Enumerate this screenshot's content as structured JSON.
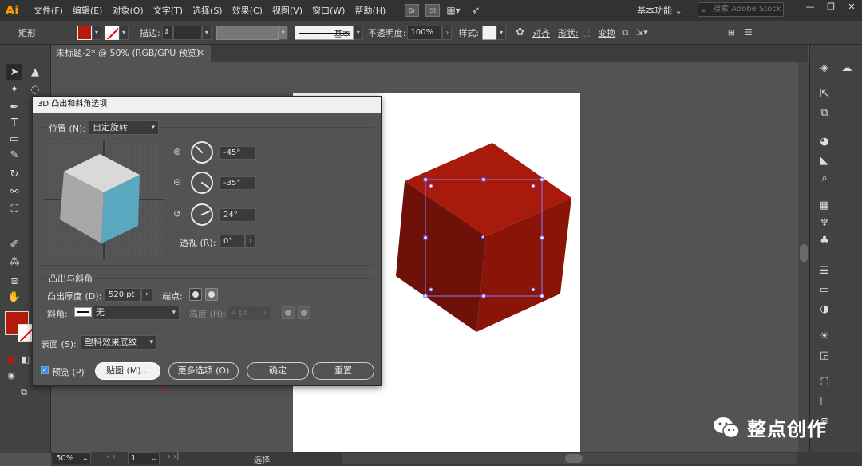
{
  "app": {
    "logo": "Ai"
  },
  "menu": {
    "items": [
      "文件(F)",
      "编辑(E)",
      "对象(O)",
      "文字(T)",
      "选择(S)",
      "效果(C)",
      "视图(V)",
      "窗口(W)",
      "帮助(H)"
    ],
    "icon_br": "Br",
    "icon_st": "St",
    "workspace": "基本功能",
    "stock_placeholder": "搜索 Adobe Stock"
  },
  "control_bar": {
    "object_label": "矩形",
    "stroke_label": "描边:",
    "stroke_style": "基本",
    "opacity_label": "不透明度:",
    "opacity_value": "100%",
    "style_label": "样式:",
    "align_label": "对齐",
    "shape_label": "形状:",
    "transform_label": "变换",
    "fill_color": "#b61a0c"
  },
  "document": {
    "tab_title": "未标题-2* @ 50% (RGB/GPU 预览)"
  },
  "status_bar": {
    "zoom": "50%",
    "page": "1",
    "status": "选择"
  },
  "dialog": {
    "title": "3D 凸出和斜角选项",
    "position_label": "位置 (N):",
    "position_value": "自定旋转",
    "rot_x": "-45°",
    "rot_y": "-35°",
    "rot_z": "24°",
    "perspective_label": "透视 (R):",
    "perspective_value": "0°",
    "extrude_group": "凸出与斜角",
    "depth_label": "凸出厚度 (D):",
    "depth_value": "520 pt",
    "cap_label": "端点:",
    "bevel_label": "斜角:",
    "bevel_value": "无",
    "height_label": "高度 (H):",
    "height_value": "4 pt",
    "surface_label": "表面 (S):",
    "surface_value": "塑料效果底纹",
    "preview_label": "预览 (P)",
    "map_button": "贴图 (M)...",
    "more_button": "更多选项 (O)",
    "ok_button": "确定",
    "reset_button": "重置"
  },
  "colors": {
    "cube_top": "#a81a0c",
    "cube_left": "#6e1209",
    "cube_right": "#8b1409",
    "preview_cube_top": "#d9d9d9",
    "preview_cube_left": "#a8a8a8",
    "preview_cube_right": "#5aa8c0",
    "annotation_arrow": "#e0202a"
  },
  "watermark": {
    "text": "整点创作"
  }
}
